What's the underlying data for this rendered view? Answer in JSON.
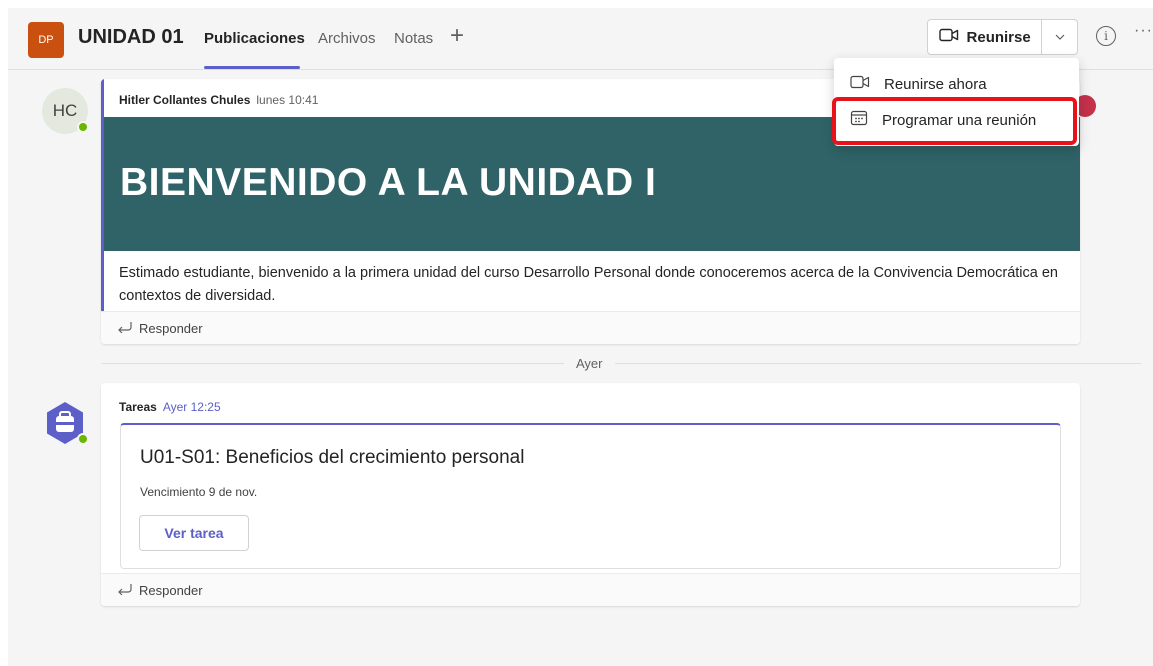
{
  "header": {
    "team_initials": "DP",
    "team_name": "UNIDAD 01",
    "tabs": [
      {
        "label": "Publicaciones",
        "active": true
      },
      {
        "label": "Archivos",
        "active": false
      },
      {
        "label": "Notas",
        "active": false
      }
    ],
    "meet_label": "Reunirse"
  },
  "menu": {
    "items": [
      {
        "label": "Reunirse ahora",
        "icon": "video-icon"
      },
      {
        "label": "Programar una reunión",
        "icon": "calendar-icon"
      }
    ]
  },
  "posts": [
    {
      "avatar": "HC",
      "author": "Hitler Collantes Chules",
      "time": "lunes 10:41",
      "banner": "BIENVENIDO A LA UNIDAD I",
      "body": "Estimado estudiante, bienvenido a la primera unidad del curso Desarrollo Personal donde conoceremos acerca de la Convivencia Democrática en contextos de diversidad.",
      "reply": "Responder"
    },
    {
      "author": "Tareas",
      "time": "Ayer 12:25",
      "card_title": "U01-S01: Beneficios del crecimiento personal",
      "card_due": "Vencimiento 9 de nov.",
      "card_button": "Ver tarea",
      "reply": "Responder"
    }
  ],
  "day_separator": "Ayer",
  "colors": {
    "accent": "#5b5fc7",
    "team_avatar": "#ca5010",
    "banner": "#2f6367",
    "highlight": "#e8121b",
    "presence": "#6bb700"
  }
}
